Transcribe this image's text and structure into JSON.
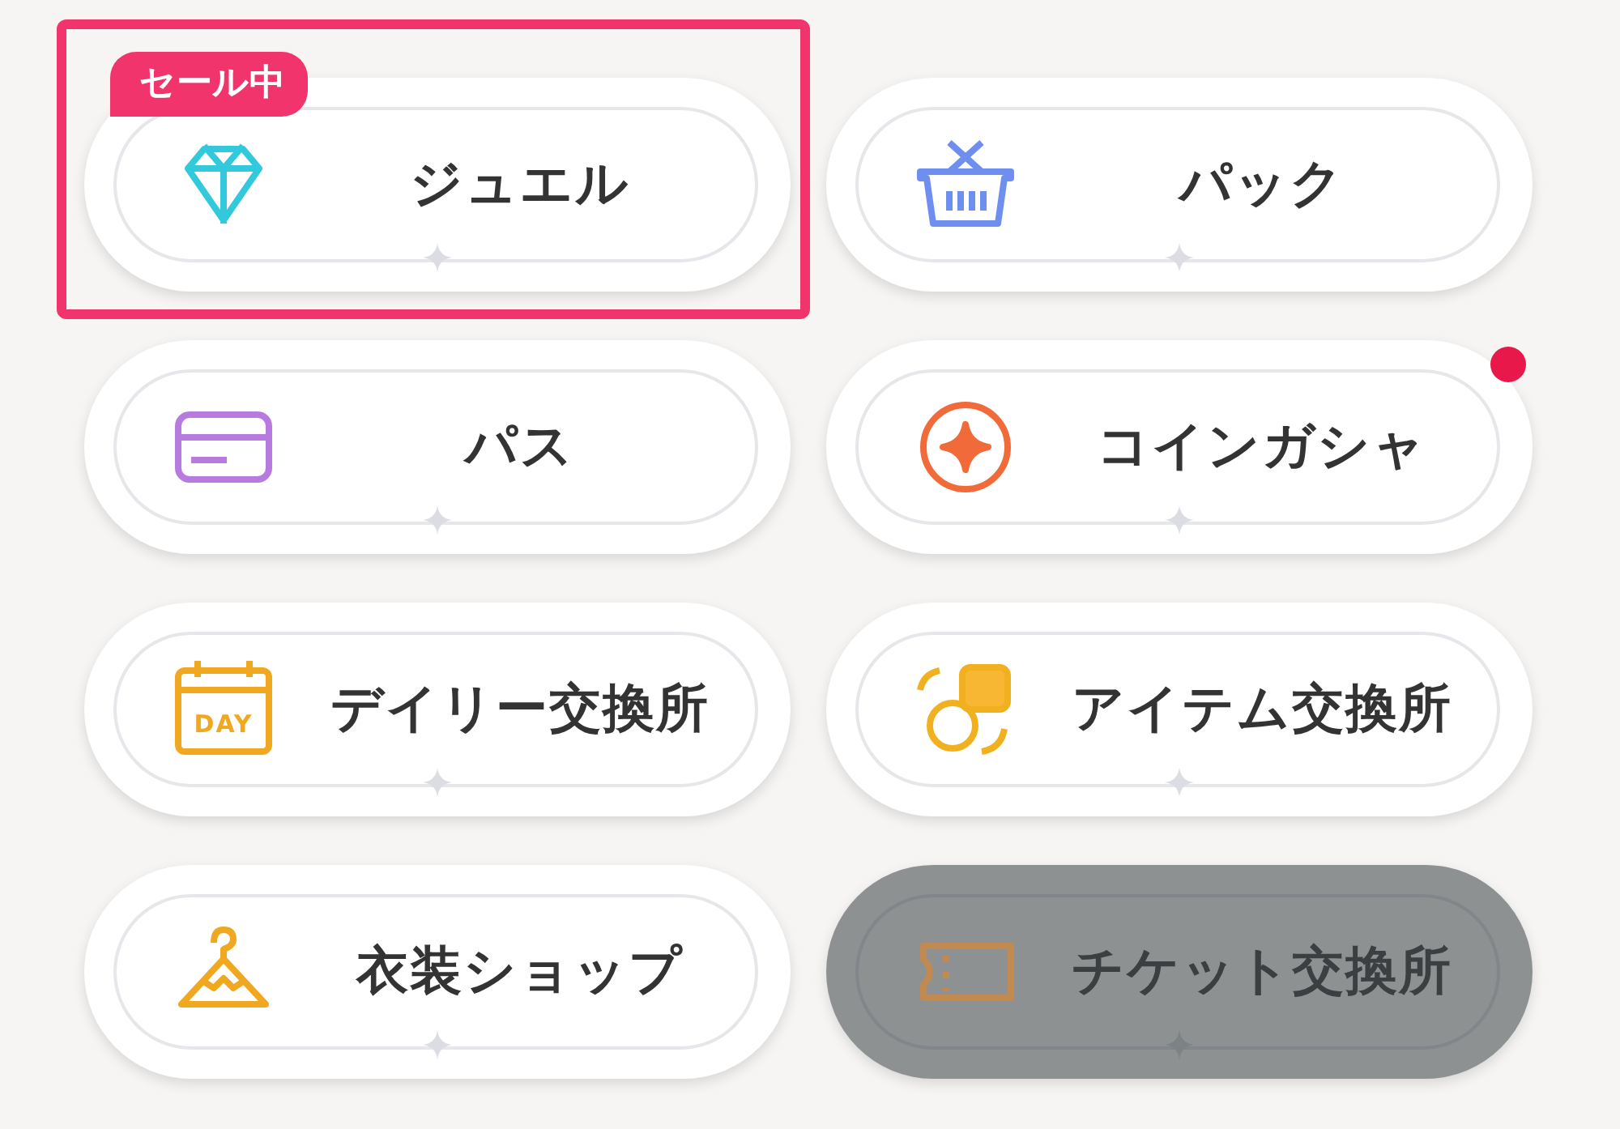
{
  "shop_menu": [
    {
      "label": "ジュエル",
      "selected": true,
      "badge": "セール中",
      "notification": false,
      "disabled": false
    },
    {
      "label": "パック",
      "selected": false,
      "notification": false,
      "disabled": false
    },
    {
      "label": "パス",
      "selected": false,
      "notification": false,
      "disabled": false
    },
    {
      "label": "コインガシャ",
      "selected": false,
      "notification": true,
      "disabled": false
    },
    {
      "label": "デイリー交換所",
      "selected": false,
      "notification": false,
      "disabled": false,
      "icon_text": "DAY"
    },
    {
      "label": "アイテム交換所",
      "selected": false,
      "notification": false,
      "disabled": false
    },
    {
      "label": "衣装ショップ",
      "selected": false,
      "notification": false,
      "disabled": false
    },
    {
      "label": "チケット交換所",
      "selected": false,
      "notification": false,
      "disabled": true
    }
  ]
}
